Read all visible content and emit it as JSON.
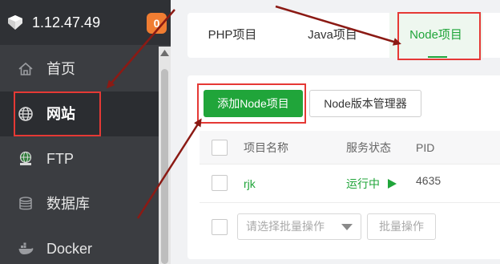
{
  "sidebar": {
    "server_ip": "1.12.47.49",
    "badge_count": "0",
    "menu": [
      {
        "label": "首页",
        "icon": "home-icon"
      },
      {
        "label": "网站",
        "icon": "globe-icon",
        "active": true
      },
      {
        "label": "FTP",
        "icon": "ftp-icon"
      },
      {
        "label": "数据库",
        "icon": "database-icon"
      },
      {
        "label": "Docker",
        "icon": "docker-icon"
      }
    ]
  },
  "tabs": [
    {
      "label": "PHP项目"
    },
    {
      "label": "Java项目"
    },
    {
      "label": "Node项目",
      "active": true
    }
  ],
  "toolbar": {
    "add_node_label": "添加Node项目",
    "node_version_manager_label": "Node版本管理器"
  },
  "table": {
    "columns": [
      "项目名称",
      "服务状态",
      "PID"
    ],
    "rows": [
      {
        "name": "rjk",
        "status": "运行中",
        "status_icon": "play-icon",
        "pid": "4635"
      }
    ]
  },
  "batch": {
    "select_placeholder": "请选择批量操作",
    "button_label": "批量操作"
  },
  "colors": {
    "sidebar_bg": "#3b3d41",
    "accent_green": "#20a53a",
    "badge_orange": "#f07d32",
    "annotation_red": "#e53935"
  }
}
